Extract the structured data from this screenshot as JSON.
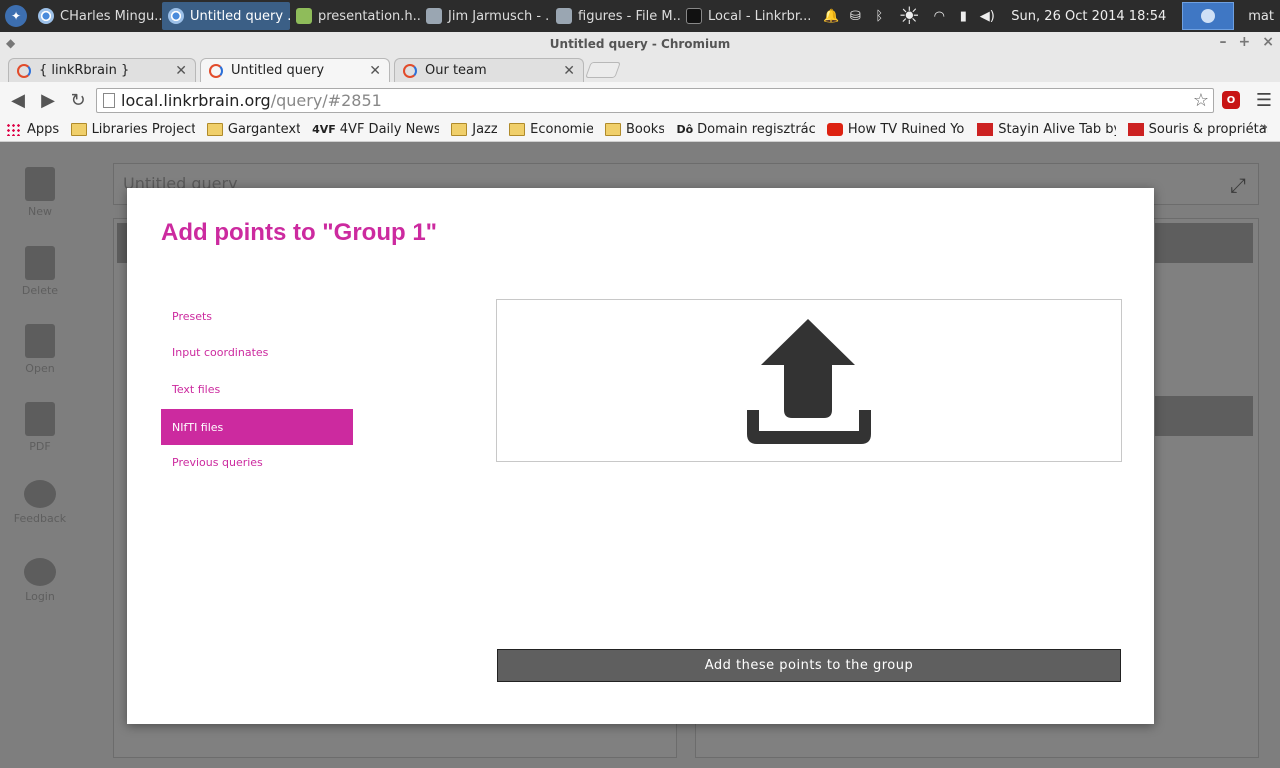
{
  "taskbar": {
    "tasks": [
      {
        "label": "CHarles Mingu...",
        "icon": "chrome-icon"
      },
      {
        "label": "Untitled query ...",
        "icon": "chrome-icon",
        "active": true
      },
      {
        "label": "presentation.h...",
        "icon": "document-icon"
      },
      {
        "label": "Jim Jarmusch - ...",
        "icon": "folder-icon"
      },
      {
        "label": "figures - File M...",
        "icon": "folder-icon"
      },
      {
        "label": "Local - Linkrbr...",
        "icon": "terminal-icon"
      }
    ],
    "clock": "Sun, 26 Oct 2014 18:54",
    "user": "mat"
  },
  "window": {
    "title": "Untitled query - Chromium"
  },
  "tabs": [
    {
      "label": "{ linkRbrain }"
    },
    {
      "label": "Untitled query",
      "active": true
    },
    {
      "label": "Our team"
    }
  ],
  "address": {
    "host": "local.linkrbrain.org",
    "path": "/query/#2851"
  },
  "bookmarks": [
    {
      "label": "Apps",
      "icon": "apps-icon"
    },
    {
      "label": "Libraries Project",
      "icon": "folder-icon"
    },
    {
      "label": "Gargantext",
      "icon": "folder-icon"
    },
    {
      "label": "4VF Daily News",
      "icon": "site-icon",
      "badge": "4VF"
    },
    {
      "label": "Jazz",
      "icon": "folder-icon"
    },
    {
      "label": "Economie",
      "icon": "folder-icon"
    },
    {
      "label": "Books",
      "icon": "folder-icon"
    },
    {
      "label": "Domain regisztráció",
      "icon": "site-icon",
      "badge": "Dô"
    },
    {
      "label": "How TV Ruined Your",
      "icon": "youtube-icon"
    },
    {
      "label": "Stayin Alive Tab by B",
      "icon": "guitar-icon"
    },
    {
      "label": "Souris & propriétair",
      "icon": "site-icon"
    }
  ],
  "bookmarks_more": "»",
  "app_sidebar": [
    {
      "label": "New",
      "icon": "new-document-icon"
    },
    {
      "label": "Delete",
      "icon": "delete-icon"
    },
    {
      "label": "Open",
      "icon": "folder-open-icon"
    },
    {
      "label": "PDF",
      "icon": "pdf-export-icon"
    },
    {
      "label": "Feedback",
      "icon": "speech-bubble-icon"
    },
    {
      "label": "Login",
      "icon": "user-icon"
    }
  ],
  "background_page": {
    "query_title": "Untitled query"
  },
  "modal": {
    "title": "Add points to \"Group 1\"",
    "menu": [
      {
        "label": "Presets"
      },
      {
        "label": "Input coordinates"
      },
      {
        "label": "Text files"
      },
      {
        "label": "NIfTI files",
        "active": true
      },
      {
        "label": "Previous queries"
      }
    ],
    "upload_icon": "upload-icon",
    "submit_label": "Add these points to the group"
  },
  "colors": {
    "accent": "#cc2a9f",
    "button": "#5f5f5f",
    "icon_dark": "#333333"
  }
}
